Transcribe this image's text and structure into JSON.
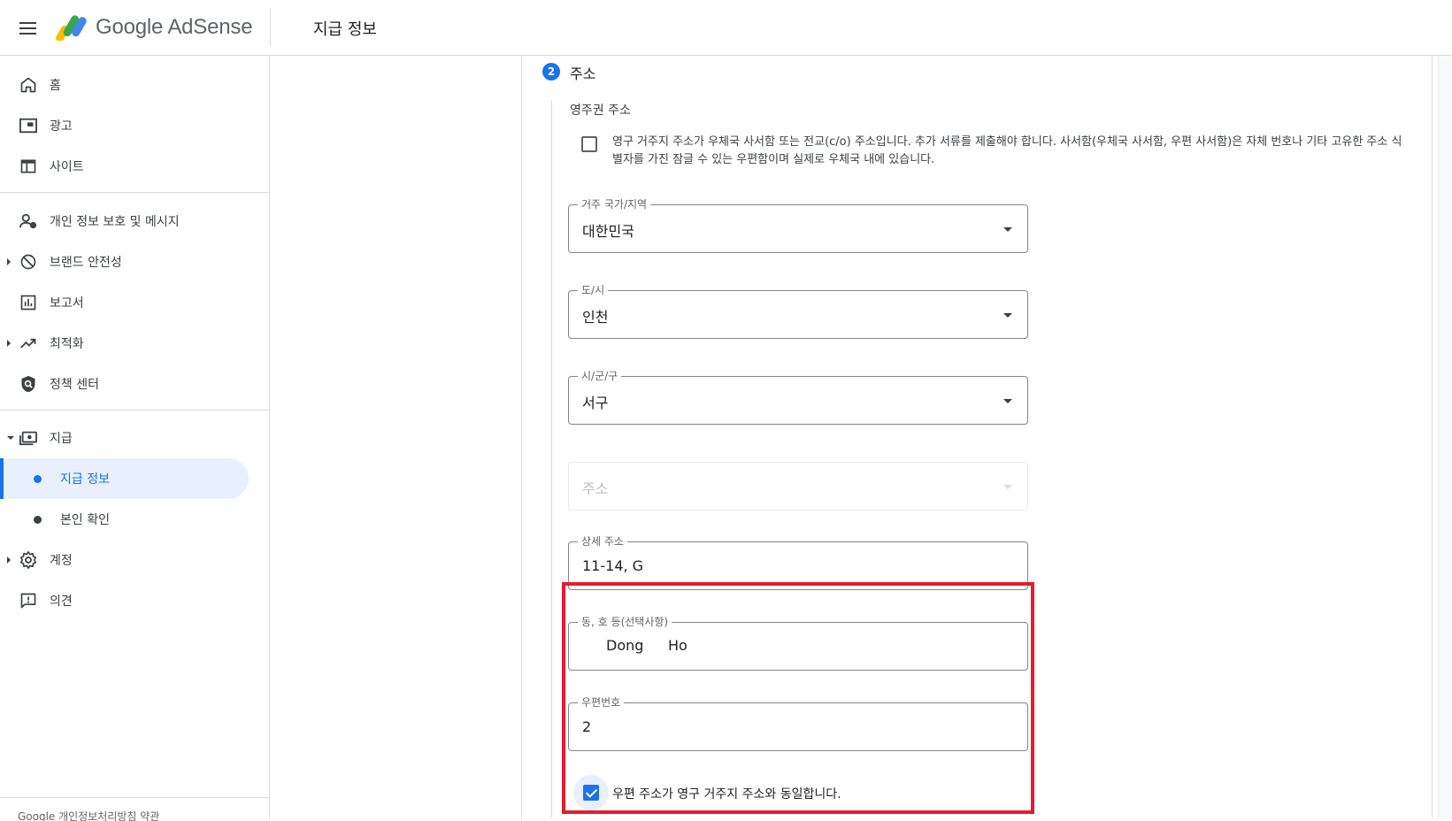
{
  "header": {
    "brand": "Google AdSense",
    "page_title": "지급 정보"
  },
  "sidebar": {
    "items": [
      {
        "label": "홈",
        "icon": "home-icon"
      },
      {
        "label": "광고",
        "icon": "ads-icon"
      },
      {
        "label": "사이트",
        "icon": "sites-icon"
      },
      {
        "label": "개인 정보 보호 및 메시지",
        "icon": "privacy-messaging-icon"
      },
      {
        "label": "브랜드 안전성",
        "icon": "block-icon"
      },
      {
        "label": "보고서",
        "icon": "reports-icon"
      },
      {
        "label": "최적화",
        "icon": "trending-up-icon"
      },
      {
        "label": "정책 센터",
        "icon": "policy-shield-icon"
      },
      {
        "label": "지급",
        "icon": "payments-icon"
      },
      {
        "label": "계정",
        "icon": "gear-icon"
      },
      {
        "label": "의견",
        "icon": "feedback-icon"
      }
    ],
    "payments_sub": [
      {
        "label": "지급 정보",
        "active": true
      },
      {
        "label": "본인 확인",
        "active": false
      }
    ],
    "footer": "Google 개인정보처리방침 약관"
  },
  "form": {
    "step_number": "2",
    "step_title": "주소",
    "section_label": "영주권 주소",
    "po_box_text": "영구 거주지 주소가 우체국 사서함 또는 전교(c/o) 주소입니다. 추가 서류를 제출해야 합니다. 사서함(우체국 사서함, 우편 사서함)은 자체 번호나 기타 고유한 주소 식별자를 가진 잠글 수 있는 우편함이며 실제로 우체국 내에 있습니다.",
    "po_box_checked": false,
    "country": {
      "label": "거주 국가/지역",
      "value": "대한민국"
    },
    "city": {
      "label": "도/시",
      "value": "인천"
    },
    "district": {
      "label": "시/군/구",
      "value": "서구"
    },
    "address": {
      "placeholder": "주소"
    },
    "detail_address": {
      "label": "상세 주소",
      "value": "11-14, G"
    },
    "dong_ho": {
      "label": "동, 호 등(선택사항)",
      "dong": "Dong",
      "ho": "Ho"
    },
    "postal_code": {
      "label": "우편번호",
      "value": "2"
    },
    "same_address_text": "우편 주소가 영구 거주지 주소와 동일합니다.",
    "same_address_checked": true
  },
  "colors": {
    "accent": "#1a73e8",
    "highlight": "#e11d2e",
    "active_bg": "#e8f0fe"
  }
}
